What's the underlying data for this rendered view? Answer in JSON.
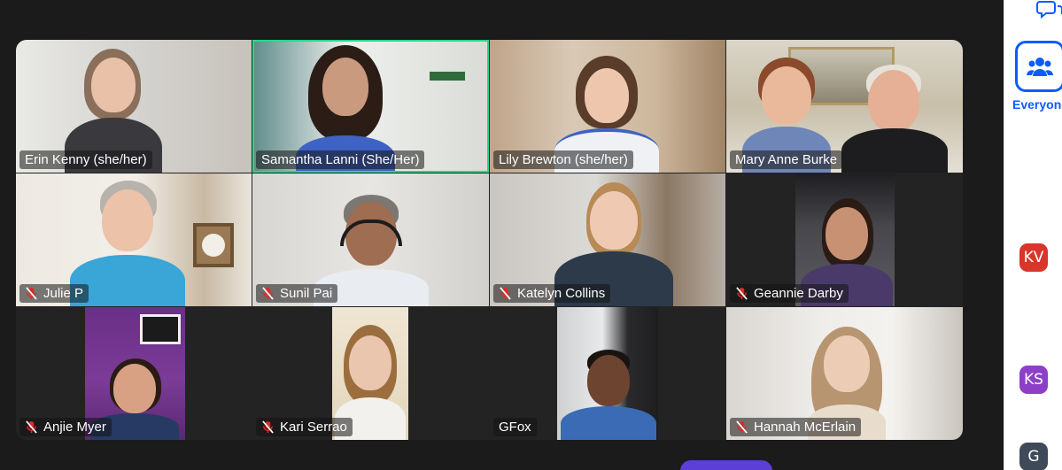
{
  "colors": {
    "stage_bg": "#1b1b1b",
    "active_speaker_border": "#23d98a",
    "accent_blue": "#0b5cff",
    "muted_icon_red": "#e02828",
    "name_tag_bg": "rgba(20,20,20,0.55)"
  },
  "participants": [
    {
      "name": "Erin Kenny (she/her)",
      "muted": false,
      "active": false
    },
    {
      "name": "Samantha Lanni (She/Her)",
      "muted": false,
      "active": true
    },
    {
      "name": "Lily Brewton (she/her)",
      "muted": false,
      "active": false
    },
    {
      "name": "Mary Anne Burke",
      "muted": false,
      "active": false
    },
    {
      "name": "Julie P",
      "muted": true,
      "active": false
    },
    {
      "name": "Sunil Pai",
      "muted": true,
      "active": false
    },
    {
      "name": "Katelyn Collins",
      "muted": true,
      "active": false
    },
    {
      "name": "Geannie Darby",
      "muted": true,
      "active": false
    },
    {
      "name": "Anjie Myer",
      "muted": true,
      "active": false
    },
    {
      "name": "Kari Serrao",
      "muted": true,
      "active": false
    },
    {
      "name": "GFox",
      "muted": false,
      "active": false
    },
    {
      "name": "Hannah McErlain",
      "muted": true,
      "active": false
    }
  ],
  "sidebar": {
    "chat_icon": "chat-bubbles-icon",
    "everyone_icon": "people-icon",
    "everyone_label": "Everyone",
    "avatars": [
      {
        "initials": "KV",
        "color": "#d9362b"
      },
      {
        "initials": "KS",
        "color": "#8d3fc8"
      },
      {
        "initials": "G",
        "color": "#3e4a57"
      }
    ]
  }
}
